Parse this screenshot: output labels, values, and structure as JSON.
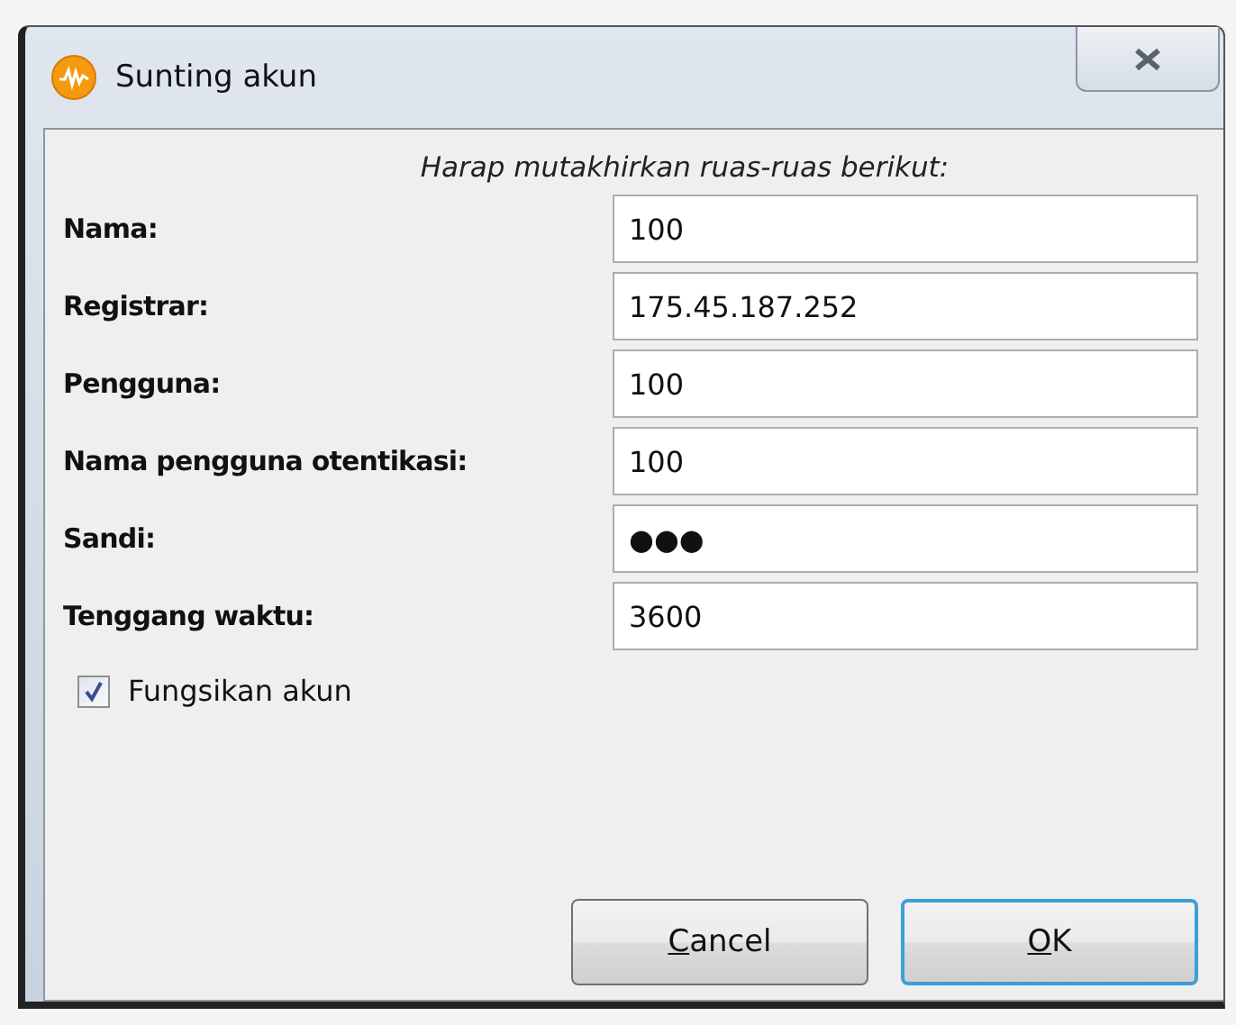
{
  "window": {
    "title": "Sunting akun"
  },
  "instruction": "Harap mutakhirkan ruas-ruas berikut:",
  "fields": [
    {
      "label": "Nama:",
      "value": "100"
    },
    {
      "label": "Registrar:",
      "value": "175.45.187.252"
    },
    {
      "label": "Pengguna:",
      "value": "100"
    },
    {
      "label": "Nama pengguna otentikasi:",
      "value": "100"
    },
    {
      "label": "Sandi:",
      "value": "●●●"
    },
    {
      "label": "Tenggang waktu:",
      "value": "3600"
    }
  ],
  "enable_account": {
    "label": "Fungsikan akun",
    "checked": true
  },
  "buttons": [
    {
      "label": "Cancel",
      "default": false
    },
    {
      "label": "OK",
      "default": true
    }
  ]
}
